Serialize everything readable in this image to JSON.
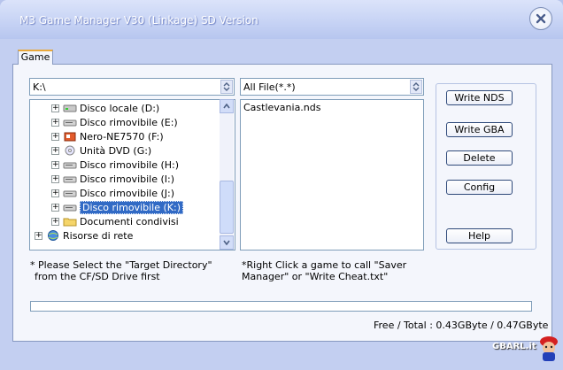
{
  "window": {
    "title": "M3 Game Manager V30 (Linkage) SD Version"
  },
  "tabs": [
    {
      "label": "Game"
    }
  ],
  "drive_combo": {
    "value": "K:\\"
  },
  "tree": {
    "items": [
      {
        "label": "Disco locale (D:)",
        "icon": "hard-drive-icon",
        "selected": false
      },
      {
        "label": "Disco rimovibile (E:)",
        "icon": "removable-drive-icon",
        "selected": false
      },
      {
        "label": "Nero-NE7570 (F:)",
        "icon": "nero-drive-icon",
        "selected": false
      },
      {
        "label": "Unità DVD (G:)",
        "icon": "dvd-drive-icon",
        "selected": false
      },
      {
        "label": "Disco rimovibile (H:)",
        "icon": "removable-drive-icon",
        "selected": false
      },
      {
        "label": "Disco rimovibile (I:)",
        "icon": "removable-drive-icon",
        "selected": false
      },
      {
        "label": "Disco rimovibile (J:)",
        "icon": "removable-drive-icon",
        "selected": false
      },
      {
        "label": "Disco rimovibile (K:)",
        "icon": "removable-drive-icon",
        "selected": true
      },
      {
        "label": "Documenti condivisi",
        "icon": "folder-icon",
        "selected": false
      },
      {
        "label": "Risorse di rete",
        "icon": "network-icon",
        "selected": false
      }
    ]
  },
  "filter_combo": {
    "value": "All File(*.*)"
  },
  "files": [
    "Castlevania.nds"
  ],
  "buttons": {
    "write_nds": "Write NDS",
    "write_gba": "Write GBA",
    "delete": "Delete",
    "config": "Config",
    "help": "Help"
  },
  "notes": {
    "left_line1": "* Please Select the \"Target Directory\"",
    "left_line2": "from the CF/SD Drive first",
    "right_line1": "*Right Click a game to call \"Saver",
    "right_line2": "Manager\" or \"Write Cheat.txt\""
  },
  "progress": {
    "value": 0
  },
  "status": "Free / Total : 0.43GByte / 0.47GByte",
  "watermark": "GBARL.it"
}
